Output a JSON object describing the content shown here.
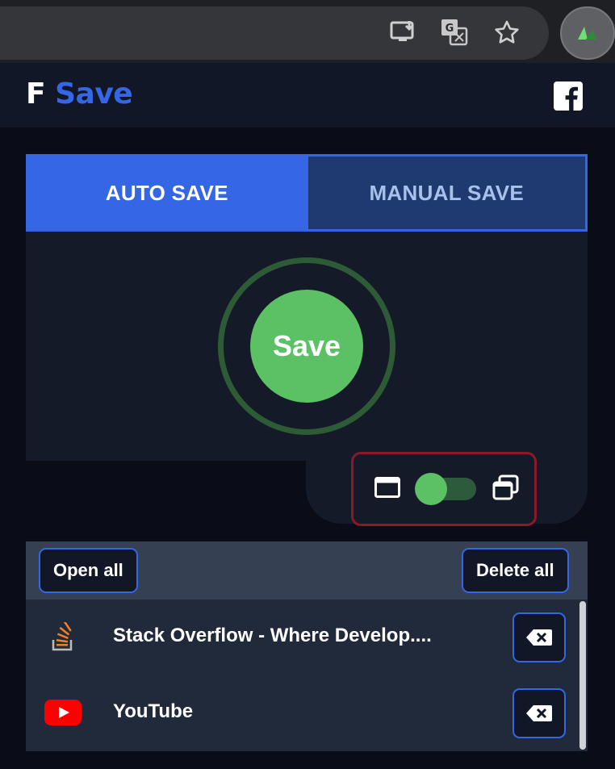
{
  "brand": {
    "letter": "F",
    "name": "Save"
  },
  "tabs": {
    "auto": "AUTO SAVE",
    "manual": "MANUAL SAVE"
  },
  "save_button": {
    "label": "Save"
  },
  "toolbar": {
    "open_all": "Open all",
    "delete_all": "Delete all"
  },
  "saved_pages": [
    {
      "title": "Stack Overflow - Where Develop....",
      "icon": "stackoverflow-icon"
    },
    {
      "title": "YouTube",
      "icon": "youtube-icon"
    }
  ],
  "window_toggle": {
    "enabled": true
  },
  "colors": {
    "accent": "#3566e6",
    "save_green": "#5cc065",
    "tab_inactive": "#1e3a6e",
    "toggle_frame": "#8a1a28"
  }
}
